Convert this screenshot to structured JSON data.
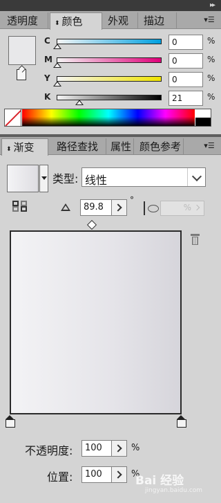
{
  "top_panel": {
    "tabs": [
      {
        "label": "透明度"
      },
      {
        "label": "颜色",
        "active": true
      },
      {
        "label": "外观"
      },
      {
        "label": "描边"
      }
    ],
    "menu_icon": "panel-menu-icon"
  },
  "color": {
    "sliders": [
      {
        "label": "C",
        "value": "0",
        "unit": "%",
        "gradient": [
          "#ffffff",
          "#00a0e0"
        ]
      },
      {
        "label": "M",
        "value": "0",
        "unit": "%",
        "gradient": [
          "#ffffff",
          "#e0007a"
        ]
      },
      {
        "label": "Y",
        "value": "0",
        "unit": "%",
        "gradient": [
          "#ffffff",
          "#f0e400"
        ]
      },
      {
        "label": "K",
        "value": "21",
        "unit": "%",
        "gradient": [
          "#ffffff",
          "#000000"
        ]
      }
    ],
    "fill_color": "#e8e8ea"
  },
  "bottom_panel": {
    "tabs": [
      {
        "label": "渐变",
        "active": true
      },
      {
        "label": "路径查找"
      },
      {
        "label": "属性"
      },
      {
        "label": "颜色参考"
      }
    ],
    "menu_icon": "panel-menu-icon"
  },
  "gradient": {
    "type_label": "类型:",
    "type_value": "线性",
    "angle": "89.8",
    "degree_symbol": "°",
    "aspect_value": "",
    "aspect_unit": "%",
    "opacity_label": "不透明度:",
    "opacity_value": "100",
    "location_label": "位置:",
    "location_value": "100",
    "unit": "%",
    "colors": [
      "#f4f4f6",
      "#d6d5db"
    ]
  },
  "watermark": {
    "text": "Bai 经验",
    "sub": "jingyan.baidu.com"
  }
}
